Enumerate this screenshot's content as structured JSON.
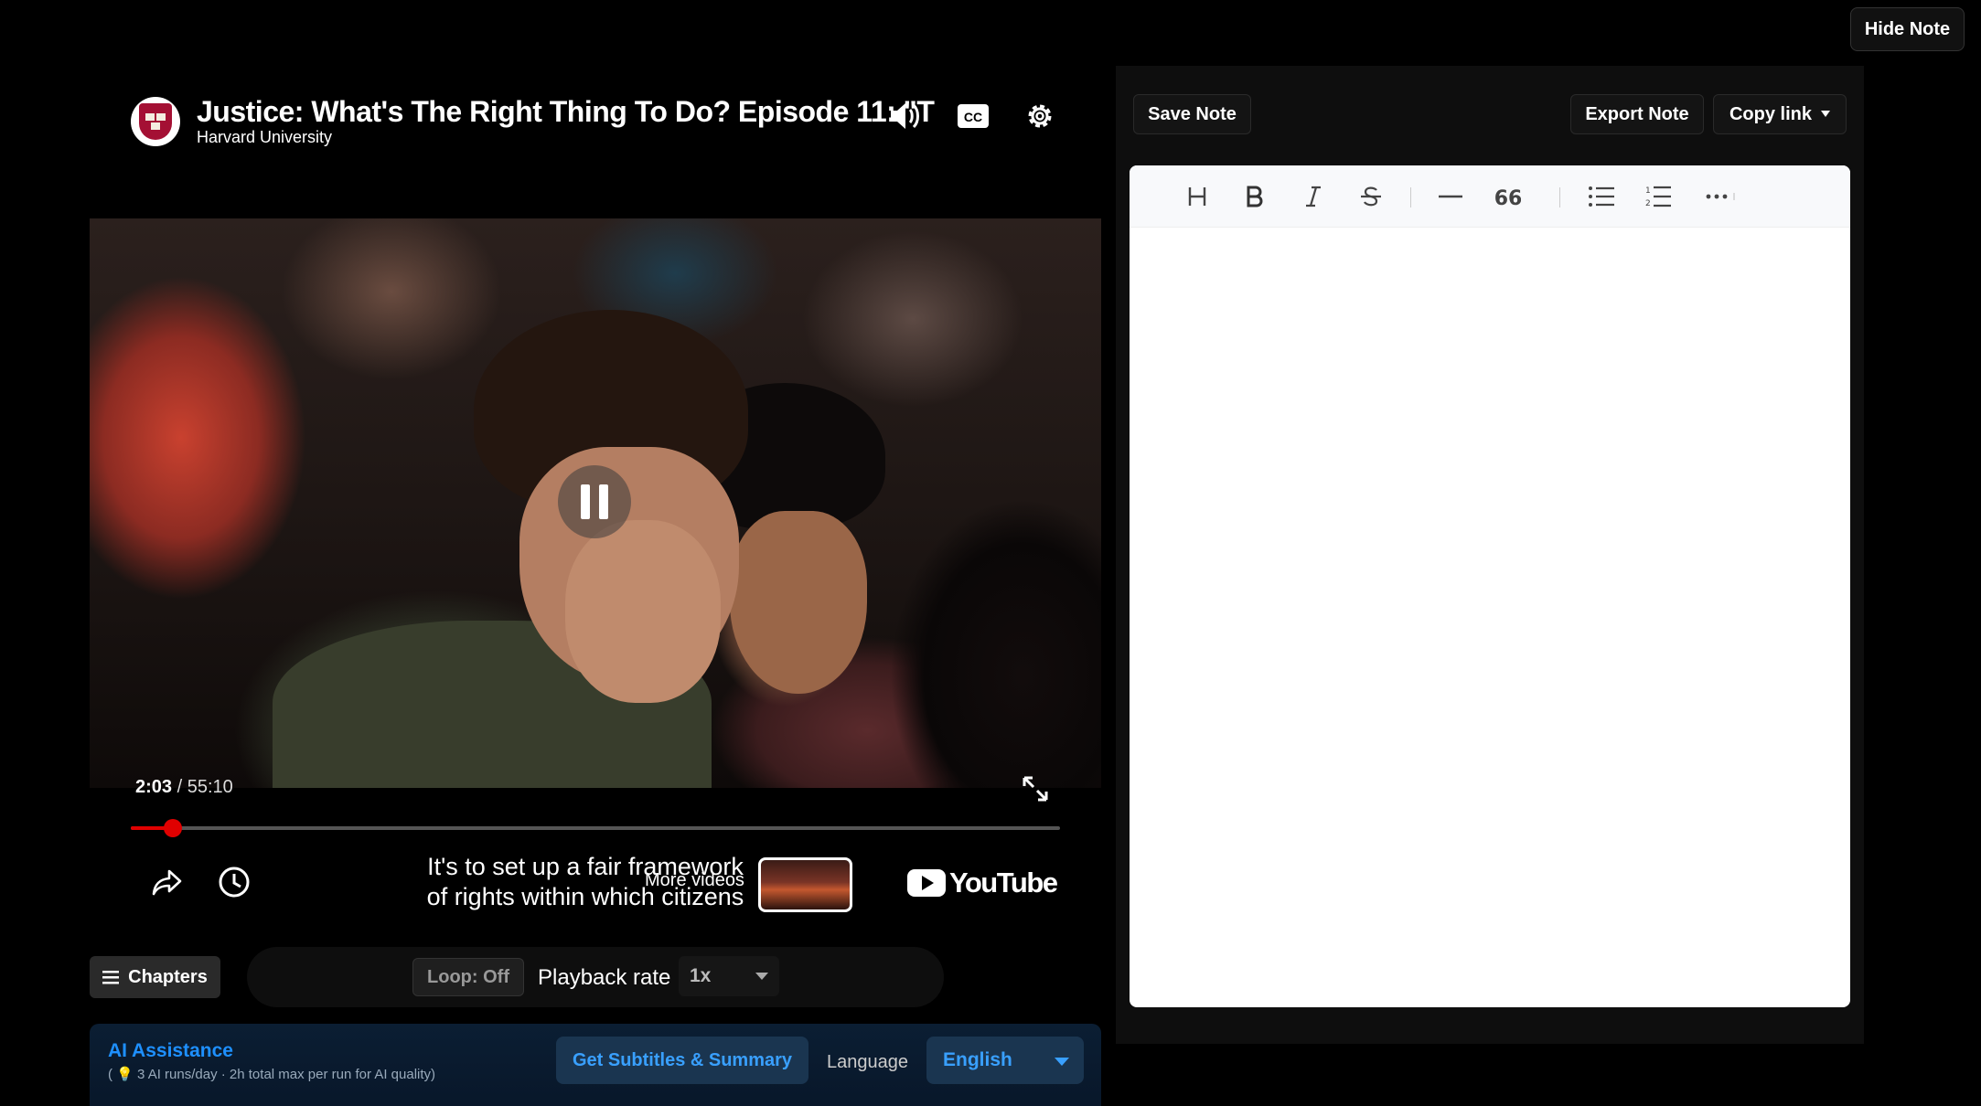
{
  "page": {
    "hide_note_label": "Hide Note"
  },
  "video": {
    "title": "Justice: What's The Right Thing To Do? Episode 11: \"T",
    "channel": "Harvard University",
    "current_time": "2:03",
    "separator": " / ",
    "duration": "55:10",
    "progress": 0.045,
    "subtitle_line1": "It's to set up a fair framework",
    "subtitle_line2": "of rights within which citizens",
    "more_videos_label": "More videos",
    "youtube_label": "YouTube"
  },
  "controls": {
    "chapters_label": "Chapters",
    "loop_label": "Loop: Off",
    "rate_label": "Playback rate",
    "rate_value": "1x"
  },
  "ai": {
    "title": "AI Assistance",
    "subtitle": "3 AI runs/day · 2h total max per run for AI quality)",
    "subtitle_prefix": "(",
    "button_label": "Get Subtitles & Summary",
    "language_label": "Language",
    "language_value": "English"
  },
  "note": {
    "save_label": "Save Note",
    "export_label": "Export Note",
    "copy_label": "Copy link",
    "content": ""
  },
  "colors": {
    "accent": "#1e90ff",
    "progress": "#e00000",
    "panel": "#0e0e0e"
  }
}
